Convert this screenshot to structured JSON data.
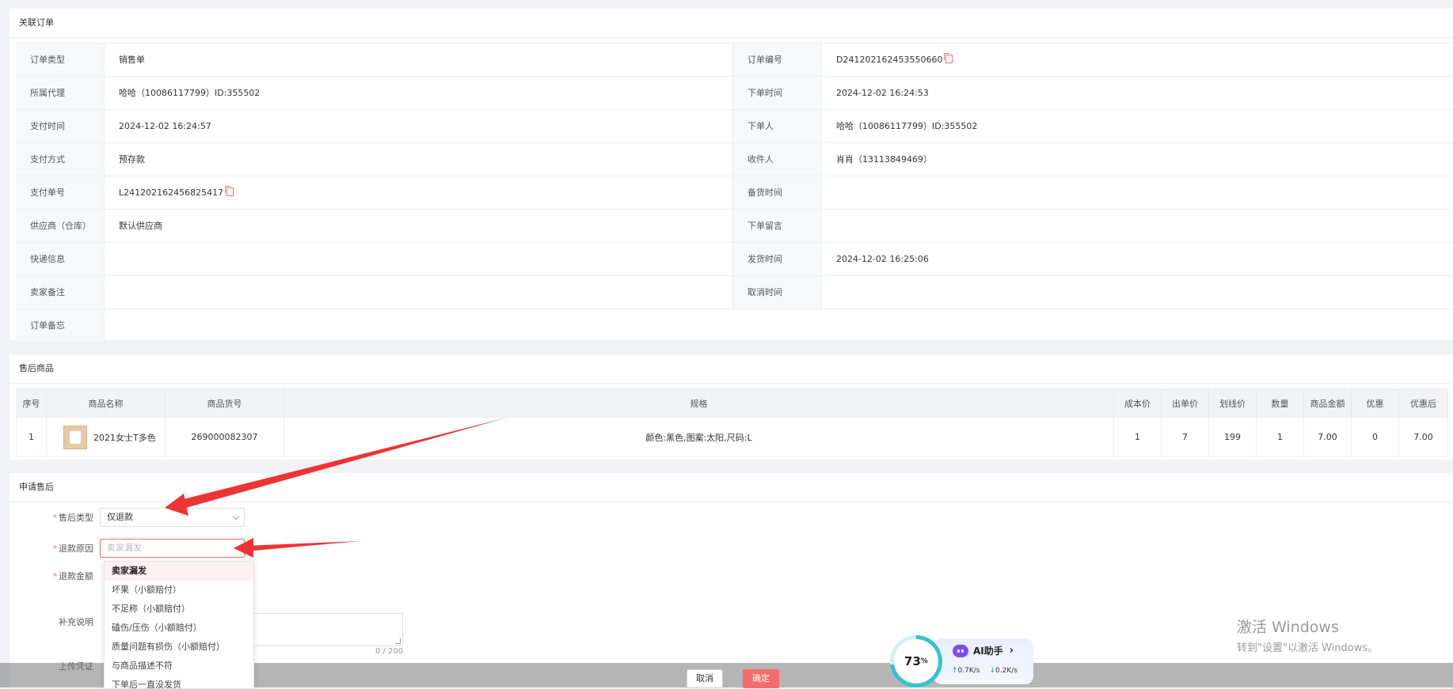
{
  "order_panel": {
    "title": "关联订单",
    "rows": [
      {
        "l_label": "订单类型",
        "l_value": "销售单",
        "r_label": "订单编号",
        "r_value": "D241202162453550660"
      },
      {
        "l_label": "所属代理",
        "l_value": "哈哈（10086117799）ID:355502",
        "r_label": "下单时间",
        "r_value": "2024-12-02 16:24:53"
      },
      {
        "l_label": "支付时间",
        "l_value": "2024-12-02 16:24:57",
        "r_label": "下单人",
        "r_value": "哈哈（10086117799）ID:355502"
      },
      {
        "l_label": "支付方式",
        "l_value": "预存款",
        "r_label": "收件人",
        "r_value": "肖肖（13113849469）"
      },
      {
        "l_label": "支付单号",
        "l_value": "L241202162456825417",
        "r_label": "备货时间",
        "r_value": ""
      },
      {
        "l_label": "供应商（仓库）",
        "l_value": "默认供应商",
        "r_label": "下单留言",
        "r_value": ""
      },
      {
        "l_label": "快递信息",
        "l_value": "",
        "r_label": "发货时间",
        "r_value": "2024-12-02 16:25:06"
      },
      {
        "l_label": "卖家备注",
        "l_value": "",
        "r_label": "取消时间",
        "r_value": ""
      },
      {
        "l_label": "订单备忘",
        "l_value": "",
        "r_label": "",
        "r_value": ""
      }
    ]
  },
  "products_panel": {
    "title": "售后商品",
    "headers": [
      "序号",
      "商品名称",
      "商品货号",
      "规格",
      "成本价",
      "出单价",
      "划线价",
      "数量",
      "商品金额",
      "优惠",
      "优惠后"
    ],
    "rows": [
      {
        "no": "1",
        "name": "2021女士T多色",
        "sku": "269000082307",
        "spec": "颜色:黑色,图案:太阳,尺码:L",
        "cost": "1",
        "price": "7",
        "list_price": "199",
        "qty": "1",
        "amount": "7.00",
        "discount": "0",
        "after_discount": "7.00"
      }
    ]
  },
  "apply_panel": {
    "title": "申请售后",
    "type_label": "售后类型",
    "type_value": "仅退款",
    "reason_label": "退款原因",
    "reason_placeholder": "卖家漏发",
    "amount_label": "退款金额",
    "note_label": "补充说明",
    "counter": "0 / 200",
    "upload_label": "上传凭证",
    "reason_options": [
      "卖家漏发",
      "坏果（小额赔付）",
      "不足称（小额赔付）",
      "磕伤/压伤（小额赔付）",
      "质量问题有损伤（小额赔付）",
      "与商品描述不符",
      "下单后一直没发货"
    ]
  },
  "footer": {
    "cancel": "取消",
    "confirm": "确定"
  },
  "ai_widget": {
    "percent": "73",
    "percent_unit": "%",
    "title": "AI助手",
    "chevron": "›",
    "up_speed": "0.7K/s",
    "down_speed": "0.2K/s",
    "progress": 0.73
  },
  "watermark": {
    "line1": "激活 Windows",
    "line2": "转到\"设置\"以激活 Windows。"
  },
  "colors": {
    "accent": "#f56c6c",
    "arrow": "#ee3333",
    "ring": "#35c1d4",
    "ai_logo": "#7b4dff"
  }
}
